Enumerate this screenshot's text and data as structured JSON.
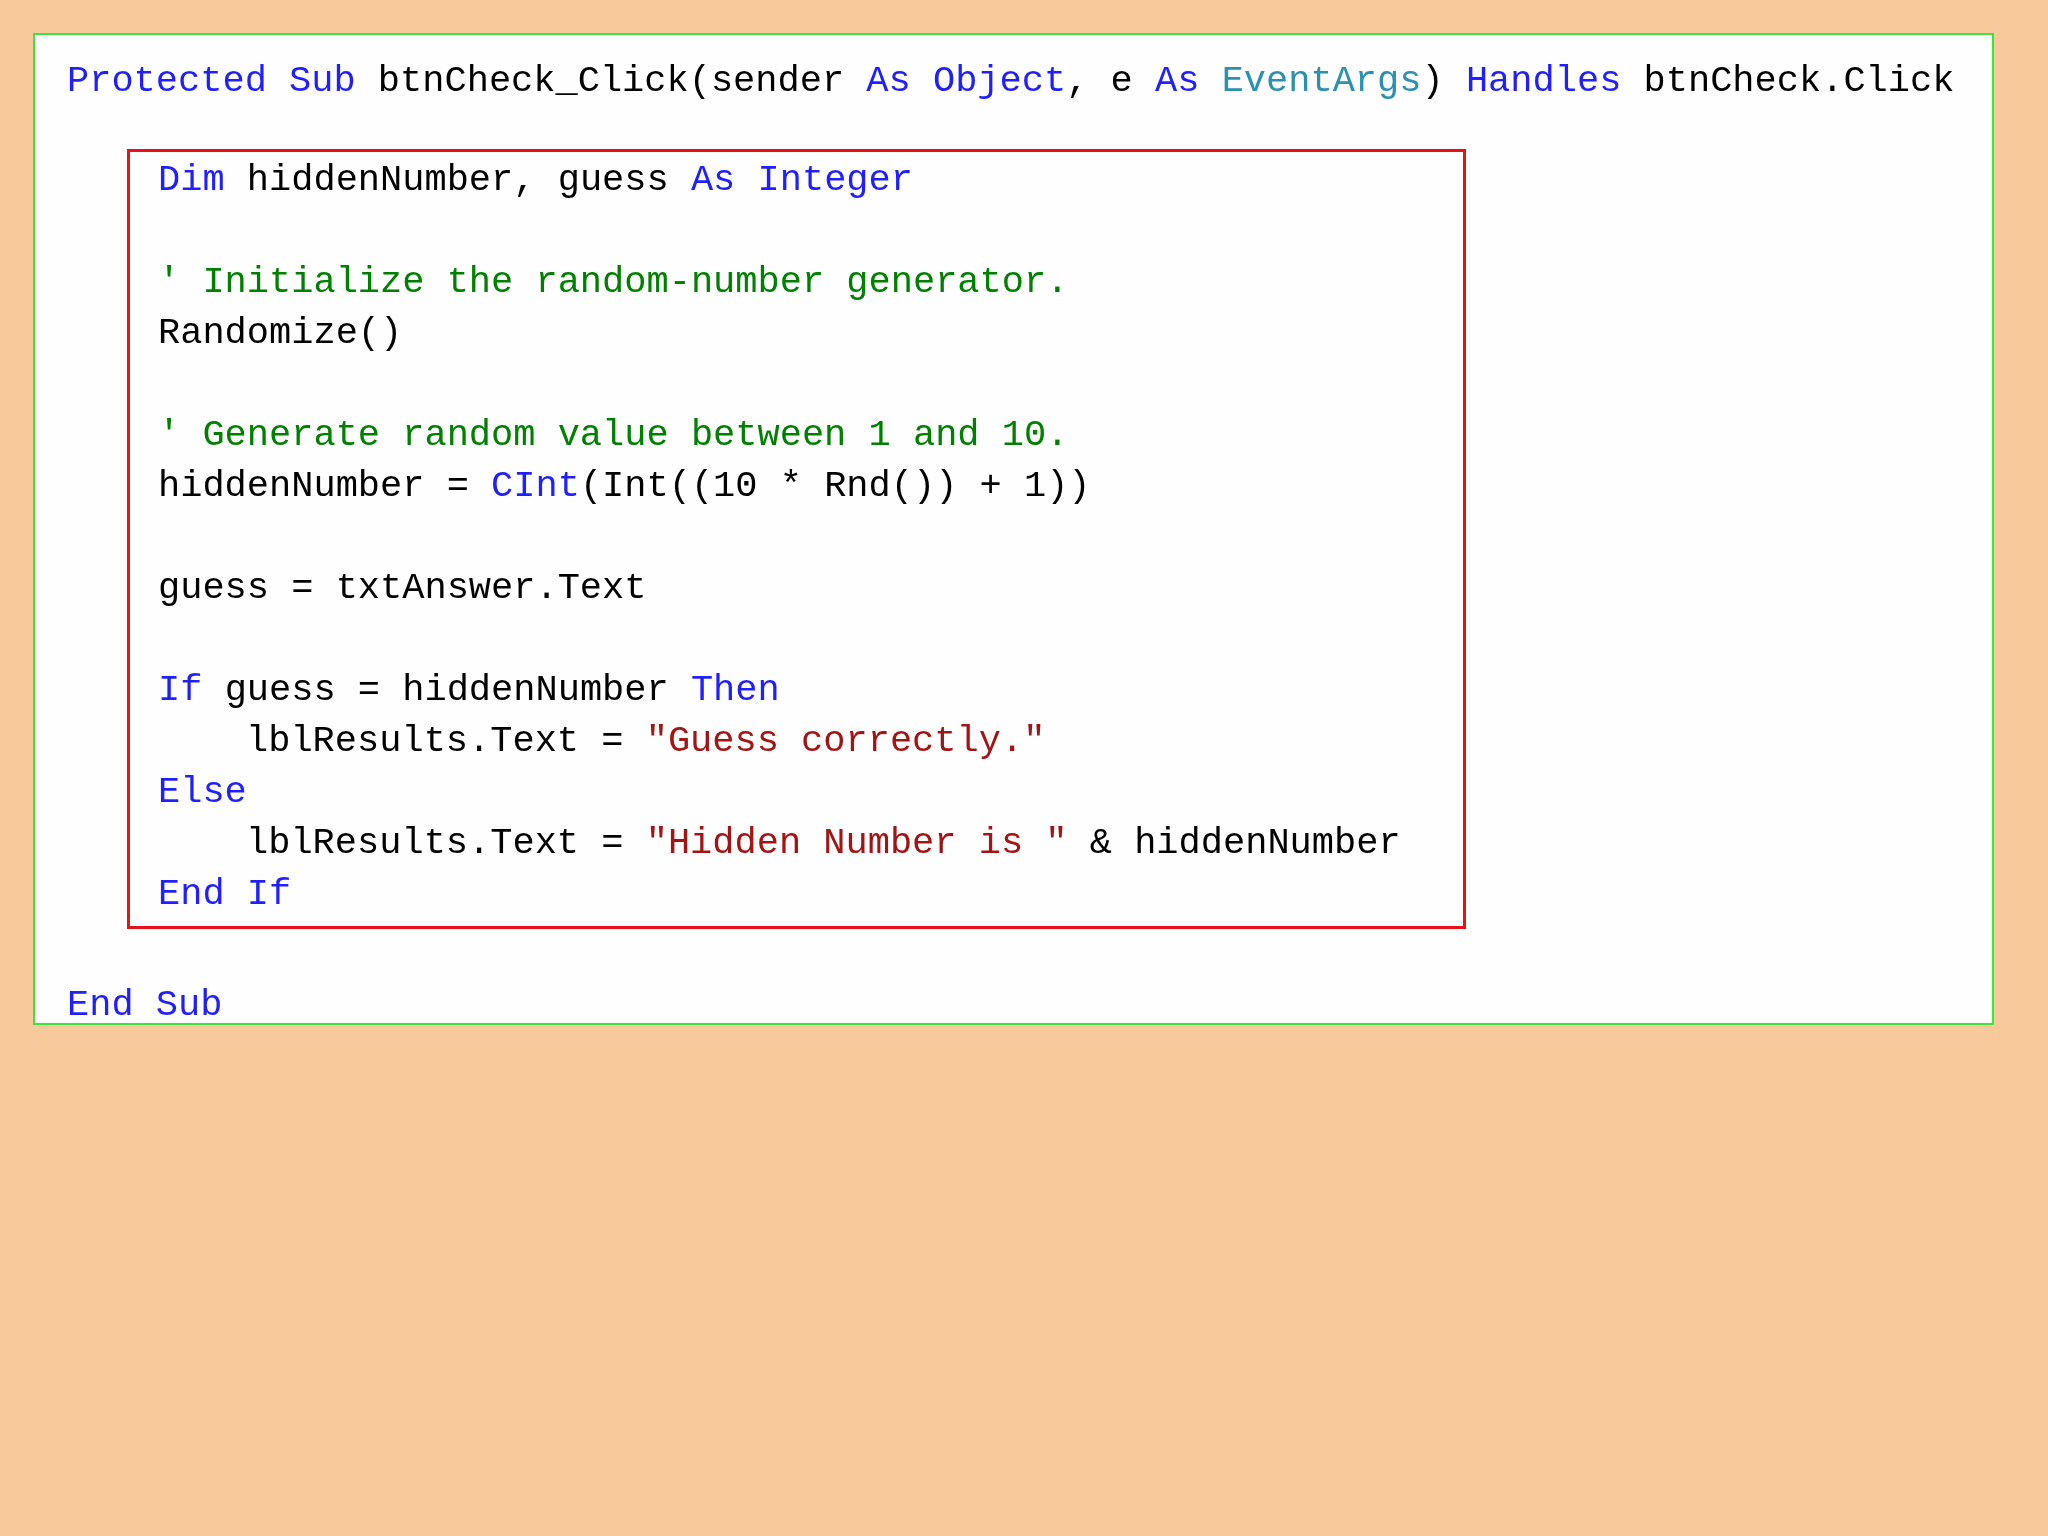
{
  "editor": {
    "header": {
      "tokens": [
        {
          "kind": "keyword",
          "text": "Protected Sub "
        },
        {
          "kind": "plain",
          "text": "btnCheck_Click(sender "
        },
        {
          "kind": "keyword",
          "text": "As Object"
        },
        {
          "kind": "plain",
          "text": ", e "
        },
        {
          "kind": "keyword",
          "text": "As "
        },
        {
          "kind": "type",
          "text": "EventArgs"
        },
        {
          "kind": "plain",
          "text": ") "
        },
        {
          "kind": "keyword",
          "text": "Handles "
        },
        {
          "kind": "plain",
          "text": "btnCheck.Click"
        }
      ]
    },
    "highlighted_block": {
      "paragraphs": [
        {
          "lines": [
            {
              "tokens": [
                {
                  "kind": "keyword",
                  "text": "Dim "
                },
                {
                  "kind": "plain",
                  "text": "hiddenNumber, guess "
                },
                {
                  "kind": "keyword",
                  "text": "As Integer"
                }
              ]
            }
          ]
        },
        {
          "lines": [
            {
              "tokens": [
                {
                  "kind": "comment",
                  "text": "' Initialize the random-number generator."
                }
              ]
            },
            {
              "tokens": [
                {
                  "kind": "plain",
                  "text": "Randomize()"
                }
              ]
            }
          ]
        },
        {
          "lines": [
            {
              "tokens": [
                {
                  "kind": "comment",
                  "text": "' Generate random value between 1 and 10."
                }
              ]
            },
            {
              "tokens": [
                {
                  "kind": "plain",
                  "text": "hiddenNumber = "
                },
                {
                  "kind": "keyword",
                  "text": "CInt"
                },
                {
                  "kind": "plain",
                  "text": "(Int((10 * Rnd()) + 1))"
                }
              ]
            }
          ]
        },
        {
          "lines": [
            {
              "tokens": [
                {
                  "kind": "plain",
                  "text": "guess = txtAnswer.Text"
                }
              ]
            }
          ]
        },
        {
          "lines": [
            {
              "tokens": [
                {
                  "kind": "keyword",
                  "text": "If "
                },
                {
                  "kind": "plain",
                  "text": "guess = hiddenNumber "
                },
                {
                  "kind": "keyword",
                  "text": "Then"
                }
              ],
              "children": [
                {
                  "tokens": [
                    {
                      "kind": "plain",
                      "text": "lblResults.Text = "
                    },
                    {
                      "kind": "string",
                      "text": "\"Guess correctly.\""
                    }
                  ]
                }
              ]
            },
            {
              "tokens": [
                {
                  "kind": "keyword",
                  "text": "Else"
                }
              ],
              "children": [
                {
                  "tokens": [
                    {
                      "kind": "plain",
                      "text": "lblResults.Text = "
                    },
                    {
                      "kind": "string",
                      "text": "\"Hidden Number is \""
                    },
                    {
                      "kind": "plain",
                      "text": " & hiddenNumber"
                    }
                  ]
                }
              ]
            },
            {
              "tokens": [
                {
                  "kind": "keyword",
                  "text": "End If"
                }
              ]
            }
          ]
        }
      ]
    },
    "footer": {
      "tokens": [
        {
          "kind": "keyword",
          "text": "End Sub"
        }
      ]
    }
  }
}
